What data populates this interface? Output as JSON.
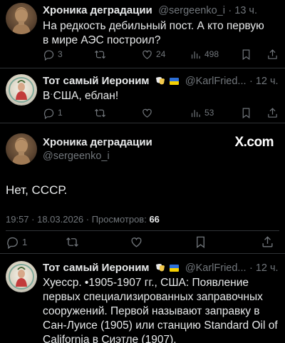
{
  "tweet1": {
    "name": "Хроника деградации",
    "handle": "@sergeenko_i",
    "time": "· 13 ч.",
    "text": "На редкость дебильный пост. А кто первую в мире АЭС построил?",
    "replies": "3",
    "likes": "24",
    "views": "498"
  },
  "tweet2": {
    "name": "Тот самый Иероним",
    "handle": "@KarlFried...",
    "time": "· 12 ч.",
    "text": "В США, еблан!",
    "replies": "1",
    "views": "53"
  },
  "main": {
    "name": "Хроника деградации",
    "handle": "@sergeenko_i",
    "watermark": "X.com",
    "text": "Нет, СССР.",
    "meta": "19:57 · 18.03.2026 · Просмотров: ",
    "views": "66",
    "replies": "1"
  },
  "tweet3": {
    "name": "Тот самый Иероним",
    "handle": "@KarlFried...",
    "time": "· 12 ч.",
    "text": "Хуесср. •1905-1907 гг., США: Появление первых специализированных заправочных сооружений. Первой называют заправку в Сан-Луисе (1905) или станцию Standard Oil of California в Сиэтле (1907)."
  },
  "colors": {
    "background": "#000000",
    "text": "#e7e9ea",
    "muted": "#71767b",
    "divider": "#2f3336"
  },
  "icons": [
    "reply-icon",
    "retweet-icon",
    "like-icon",
    "views-icon",
    "bookmark-icon",
    "share-icon",
    "more-icon",
    "theater-mask-emoji",
    "ukraine-flag-emoji"
  ]
}
